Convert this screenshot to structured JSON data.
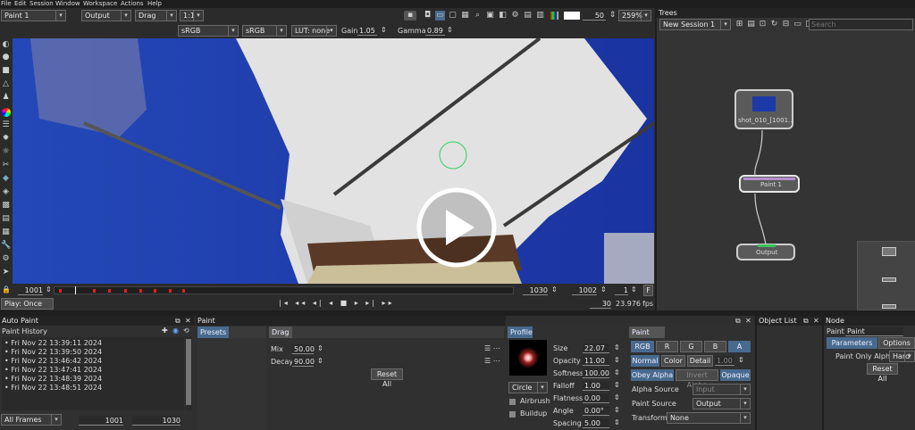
{
  "menu": [
    "File",
    "Edit",
    "Session",
    "Window",
    "Workspace",
    "Actions",
    "Help"
  ],
  "toolbar": {
    "paint_node": "Paint 1",
    "output": "Output",
    "drag": "Drag",
    "ratio": "1:1",
    "frame": "50",
    "zoom": "259%"
  },
  "viewer_controls": {
    "cs1": "sRGB",
    "cs2": "sRGB",
    "lut": "LUT: none",
    "gain_label": "Gain",
    "gain": "1.05",
    "gamma_label": "Gamma",
    "gamma": "0.89"
  },
  "timeline": {
    "start": "1001",
    "mark_in": "1030",
    "current": "1002",
    "step": "1",
    "play_mode": "Play: Once",
    "fps_step": "30",
    "fps": "23.976",
    "fps_unit": "fps"
  },
  "trees": {
    "title": "Trees",
    "session": "New Session 1",
    "search_placeholder": "Search",
    "node_source": "shot_010_[1001...",
    "node_paint": "Paint 1",
    "node_output": "Output"
  },
  "autopaint": {
    "title": "Auto Paint",
    "history_label": "Paint History",
    "entries": [
      "Fri Nov 22 13:39:11 2024",
      "Fri Nov 22 13:39:50 2024",
      "Fri Nov 22 13:46:42 2024",
      "Fri Nov 22 13:47:41 2024",
      "Fri Nov 22 13:48:39 2024",
      "Fri Nov 22 13:48:51 2024"
    ],
    "frames": "All Frames",
    "from": "1001",
    "to": "1030"
  },
  "paint_panel": {
    "title": "Paint",
    "presets": "Presets",
    "drag": "Drag",
    "mix_label": "Mix",
    "mix": "50.00",
    "decay_label": "Decay",
    "decay": "90.00",
    "reset": "Reset All"
  },
  "profile": {
    "title": "Profile",
    "shape": "Circle",
    "airbrush": "Airbrush",
    "buildup": "Buildup",
    "size_label": "Size",
    "size": "22.07",
    "opacity_label": "Opacity",
    "opacity": "11.00",
    "softness_label": "Softness",
    "softness": "100.00",
    "falloff_label": "Falloff",
    "falloff": "1.00",
    "flatness_label": "Flatness",
    "flatness": "0.00",
    "angle_label": "Angle",
    "angle": "0.00°",
    "spacing_label": "Spacing",
    "spacing": "5.00"
  },
  "paint_tab": {
    "title": "Paint",
    "channels": [
      "RGB",
      "R",
      "G",
      "B",
      "A"
    ],
    "modes": [
      "Normal",
      "Color",
      "Detail"
    ],
    "detail_val": "1.00",
    "obey_alpha": "Obey Alpha",
    "invert_alpha": "Invert Alpha",
    "opaque": "Opaque",
    "alpha_source_label": "Alpha Source",
    "alpha_source": "Input",
    "paint_source_label": "Paint Source",
    "paint_source": "Output",
    "transform_label": "Transform",
    "transform": "None"
  },
  "object_list": {
    "title": "Object List"
  },
  "node_panel": {
    "title": "Node",
    "paint_label": "Paint",
    "paint_val": "Paint",
    "tab_params": "Parameters",
    "tab_options": "Options",
    "alpha_label": "Paint Only Alpha",
    "alpha_val": "Hard",
    "reset": "Reset All"
  },
  "colors": {
    "accent": "#486a8e",
    "viewer_bg": "#1c3fa8",
    "panel": "#2f2f2f"
  }
}
